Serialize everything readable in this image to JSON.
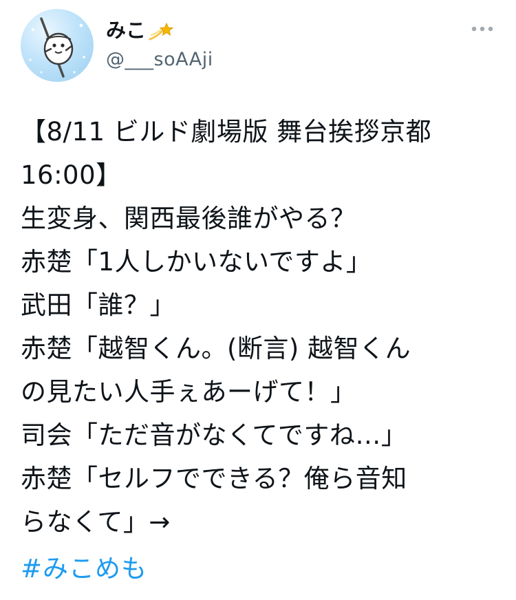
{
  "author": {
    "display_name": "みこ",
    "handle": "@___soAAji",
    "avatar_icon": "character-avatar-icon",
    "name_badge_icon": "shooting-star-icon"
  },
  "menu": {
    "icon": "more-dots-icon"
  },
  "tweet": {
    "lines": [
      "【8/11 ビルド劇場版 舞台挨拶京都",
      "16:00】",
      "生変身、関西最後誰がやる？",
      "赤楚「1人しかいないですよ」",
      "武田「誰？」",
      "赤楚「越智くん。(断言) 越智くん",
      "の見たい人手ぇあーげて！」",
      "司会「ただ音がなくてですね…」",
      "赤楚「セルフでできる？俺ら音知",
      "らなくて」→"
    ],
    "hashtag": "#みこめも"
  },
  "colors": {
    "text": "#0f1419",
    "secondary": "#536471",
    "link": "#1d9bf0",
    "avatar_bg": "#bfe3fa"
  }
}
